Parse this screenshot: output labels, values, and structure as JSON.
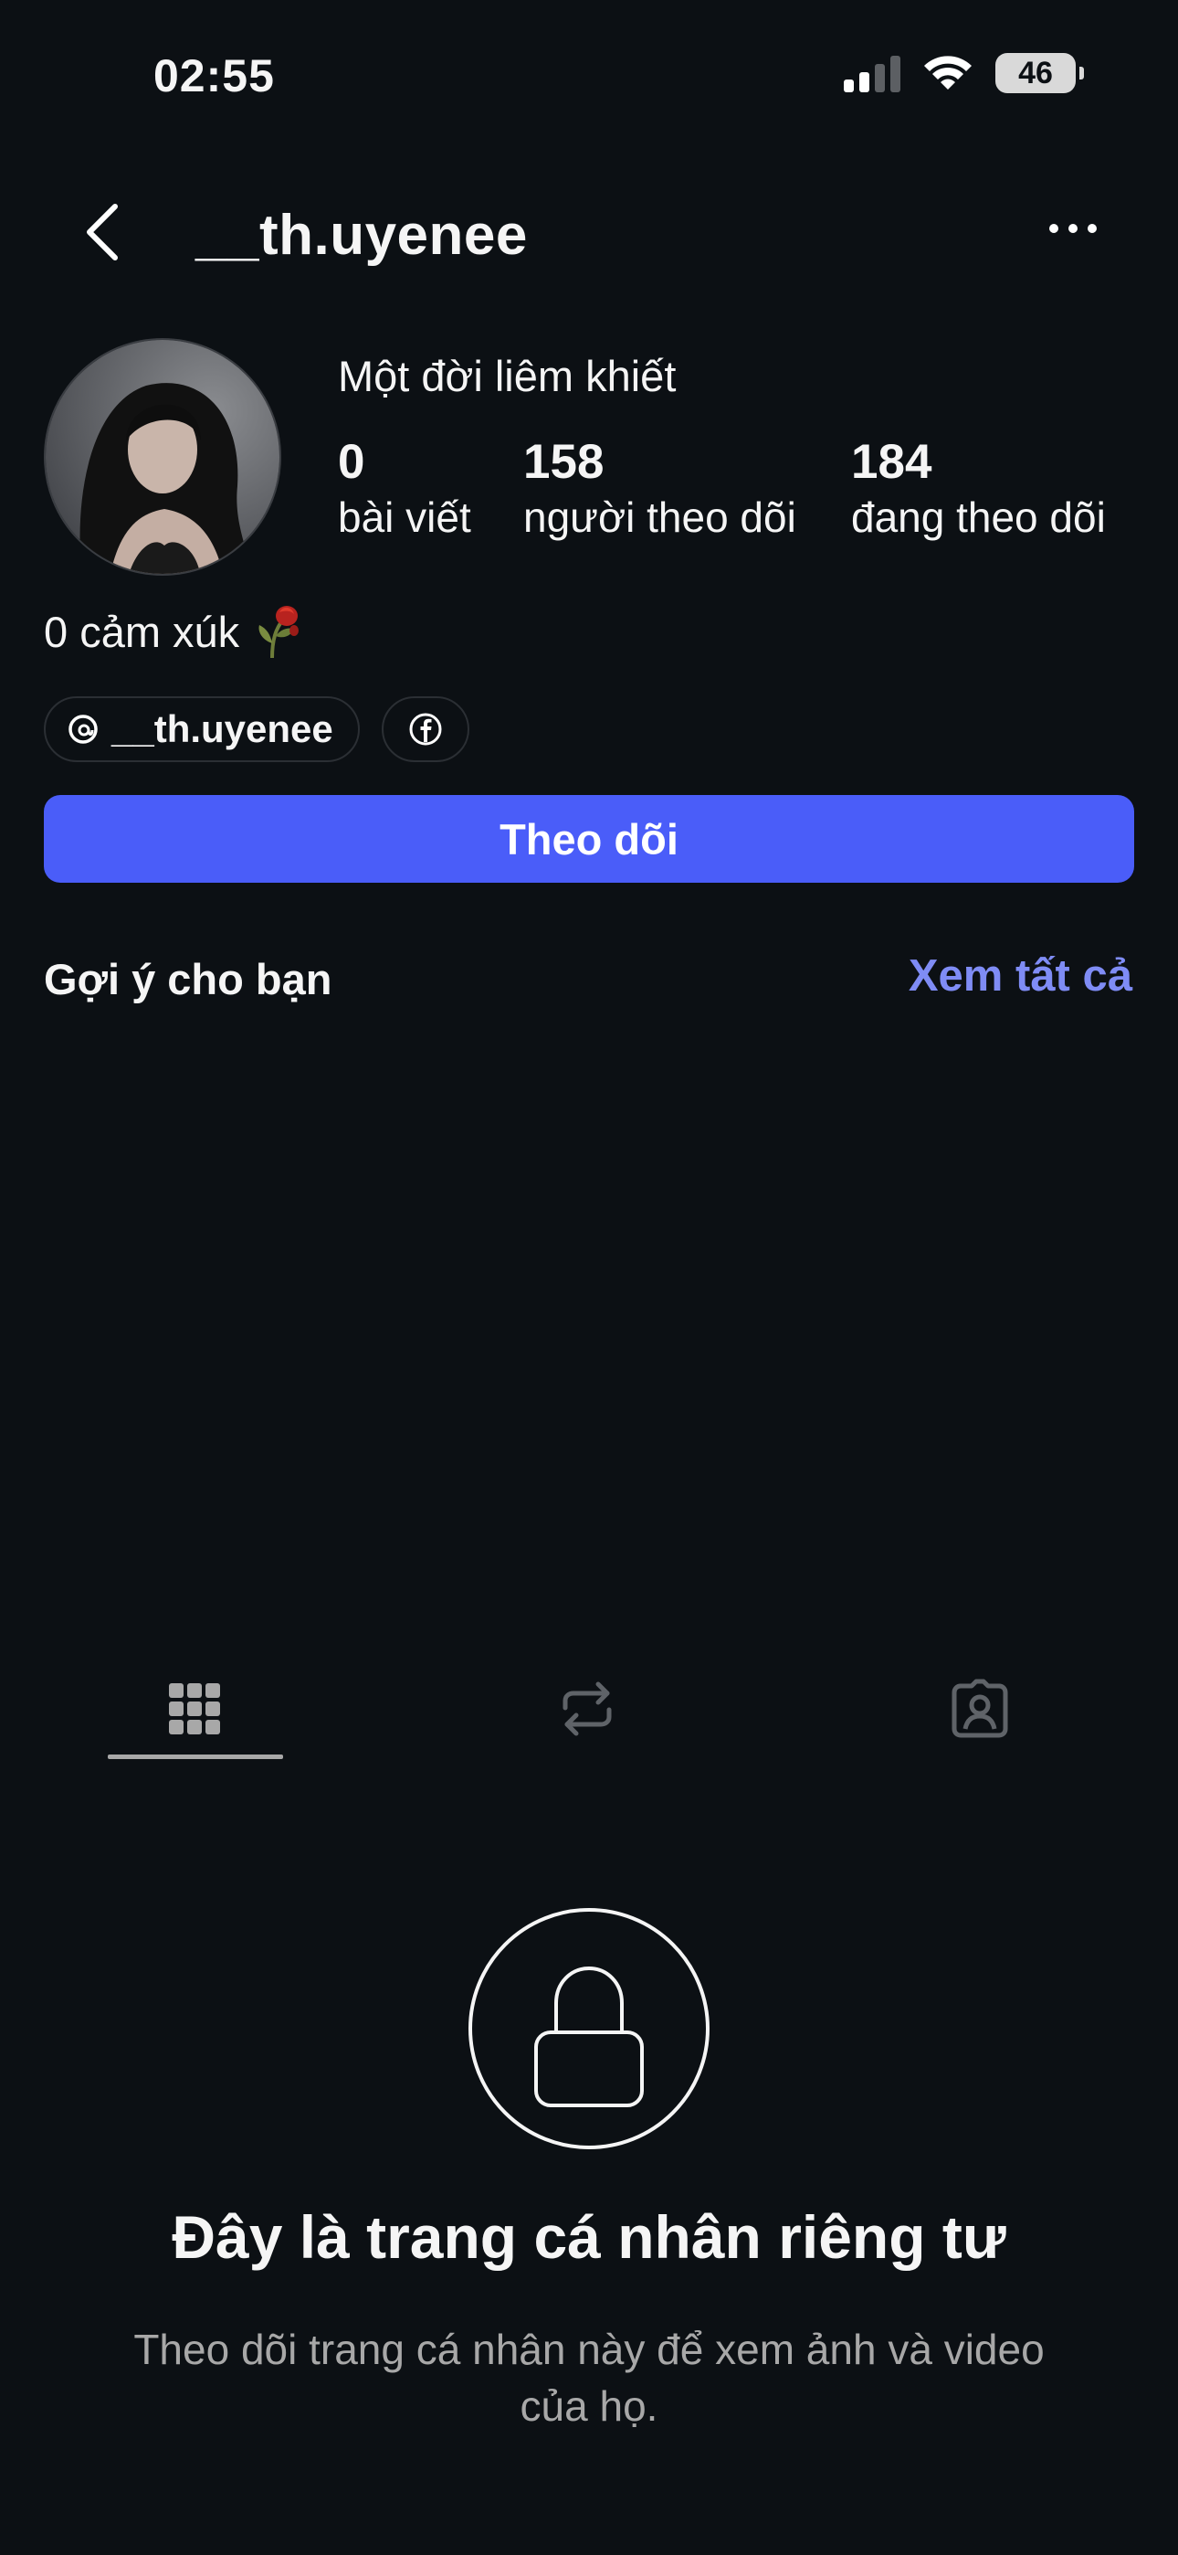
{
  "status_bar": {
    "time": "02:55",
    "battery": "46",
    "icons": [
      "cellular-signal-icon",
      "wifi-icon",
      "battery-icon"
    ]
  },
  "header": {
    "username": "__th.uyenee",
    "back_icon": "chevron-left-icon",
    "more_icon": "more-horizontal-icon"
  },
  "profile": {
    "display_name": "Một đời liêm khiết",
    "stats": {
      "posts_count": "0",
      "posts_label": "bài viết",
      "followers_count": "158",
      "followers_label": "người theo dõi",
      "following_count": "184",
      "following_label": "đang theo dõi"
    },
    "bio": "0 cảm xúk",
    "bio_emoji": "wilted-rose-emoji",
    "links": {
      "threads_handle": "__th.uyenee",
      "threads_icon": "threads-icon",
      "facebook_icon": "facebook-icon"
    }
  },
  "actions": {
    "follow_label": "Theo dõi"
  },
  "suggestions": {
    "title": "Gợi ý cho bạn",
    "see_all": "Xem tất cả"
  },
  "tabs": [
    {
      "name": "grid",
      "icon": "grid-icon",
      "active": true
    },
    {
      "name": "reposts",
      "icon": "repost-icon",
      "active": false
    },
    {
      "name": "tagged",
      "icon": "tagged-person-icon",
      "active": false
    }
  ],
  "private_notice": {
    "icon": "lock-icon",
    "title": "Đây là trang cá nhân riêng tư",
    "subtitle": "Theo dõi trang cá nhân này để xem ảnh và video của họ."
  },
  "colors": {
    "background": "#0c1014",
    "primary_button": "#4a5df9",
    "link_accent": "#7f8cf5",
    "secondary_text": "#a8a8a8"
  }
}
